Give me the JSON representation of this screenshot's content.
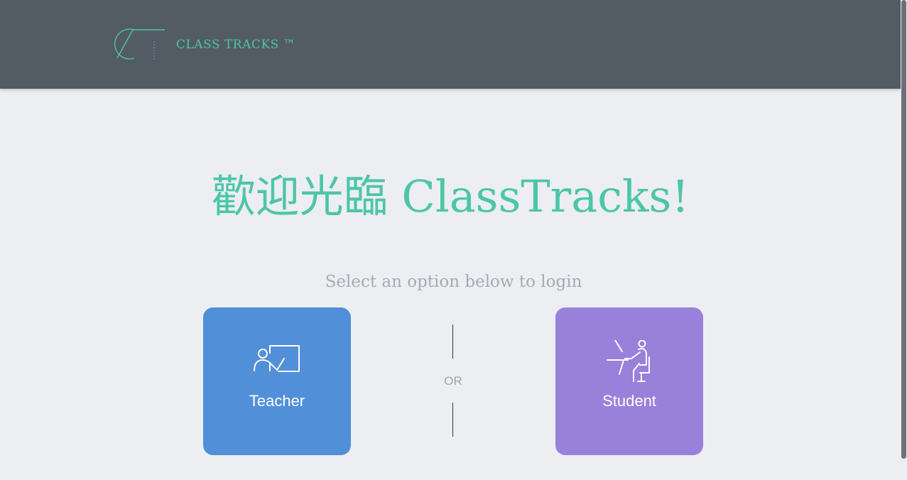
{
  "header": {
    "brand": "CLASS TRACKS ™",
    "logo_icon": "class-tracks-logo"
  },
  "main": {
    "welcome": "歡迎光臨 ClassTracks!",
    "subtitle": "Select an option below to login",
    "separator": "OR",
    "options": [
      {
        "label": "Teacher",
        "icon": "teacher-whiteboard-icon",
        "color": "#518fd9"
      },
      {
        "label": "Student",
        "icon": "student-desk-icon",
        "color": "#9980db"
      }
    ]
  },
  "colors": {
    "accent": "#4cc6a7",
    "header_bg": "#535b65",
    "page_bg": "#eceef2"
  }
}
